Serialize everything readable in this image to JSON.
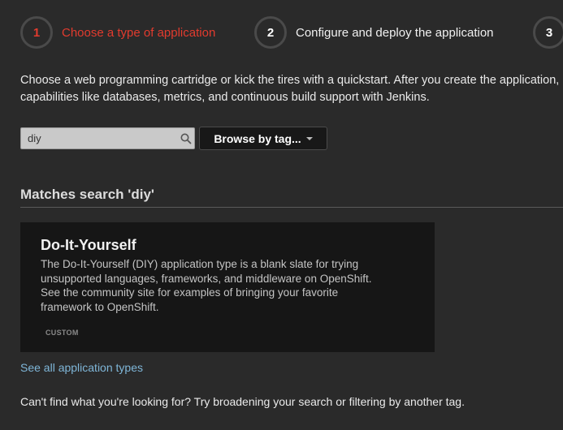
{
  "steps": [
    {
      "number": "1",
      "label": "Choose a type of application",
      "active": true
    },
    {
      "number": "2",
      "label": "Configure and deploy the application",
      "active": false
    },
    {
      "number": "3",
      "label": "",
      "active": false
    }
  ],
  "intro": {
    "line1": "Choose a web programming cartridge or kick the tires with a quickstart. After you create the application,",
    "line2": "capabilities like databases, metrics, and continuous build support with Jenkins."
  },
  "search": {
    "value": "diy",
    "icon": "magnifier-icon"
  },
  "browse": {
    "label": "Browse by tag...",
    "icon": "caret-down-icon"
  },
  "results": {
    "heading": "Matches search 'diy'",
    "items": [
      {
        "title": "Do-It-Yourself",
        "description_lines": [
          "The Do-It-Yourself (DIY) application type is a blank slate for trying",
          "unsupported languages, frameworks, and middleware on OpenShift.",
          "See the community site for examples of bringing your favorite",
          "framework to OpenShift."
        ],
        "tag": "CUSTOM"
      }
    ]
  },
  "see_all_label": "See all application types",
  "footer_note": "Can't find what you're looking for? Try broadening your search or filtering by another tag.",
  "colors": {
    "background": "#2a2a2a",
    "active_step": "#e23b2e",
    "link": "#7fb6d8",
    "card_bg": "#161616"
  }
}
